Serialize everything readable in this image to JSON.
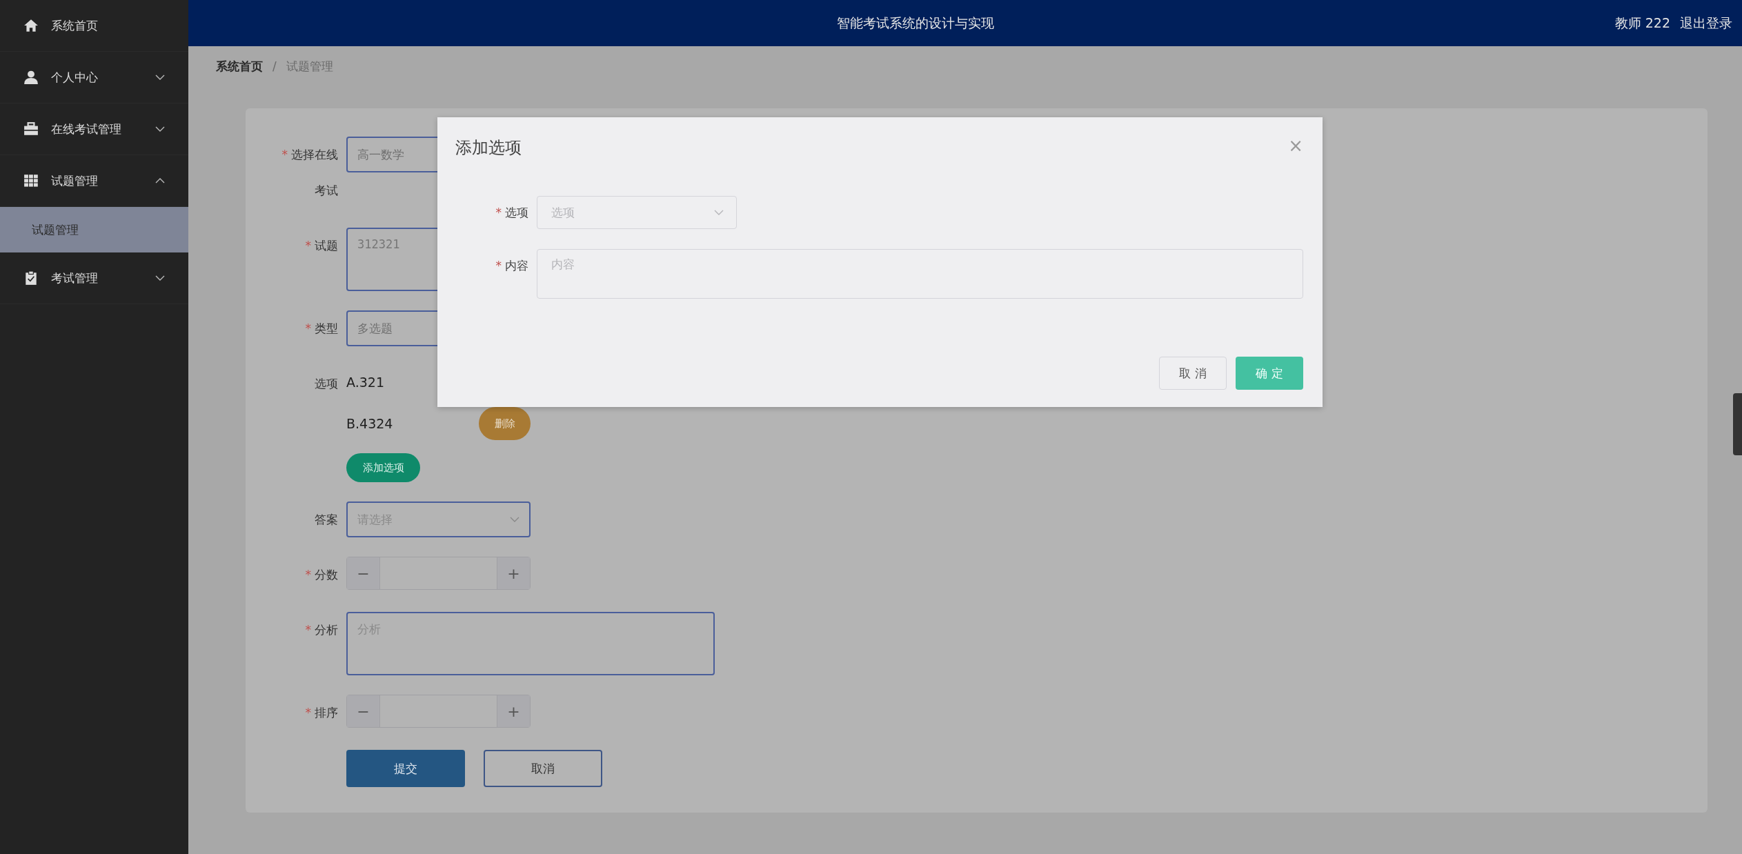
{
  "sidebar": {
    "items": [
      {
        "label": "系统首页"
      },
      {
        "label": "个人中心",
        "expanded": false
      },
      {
        "label": "在线考试管理",
        "expanded": false
      },
      {
        "label": "试题管理",
        "expanded": true,
        "children": [
          {
            "label": "试题管理",
            "selected": true
          }
        ]
      },
      {
        "label": "考试管理",
        "expanded": false
      }
    ]
  },
  "header": {
    "title": "智能考试系统的设计与实现",
    "user": "教师 222",
    "logout": "退出登录"
  },
  "breadcrumb": [
    {
      "label": "系统首页",
      "current": false
    },
    {
      "label": "试题管理",
      "current": true
    }
  ],
  "breadcrumb_separator": "/",
  "form": {
    "fields": [
      {
        "kind": "select",
        "label": "选择在线考试",
        "mark": "*",
        "value": "高一数学"
      },
      {
        "kind": "textarea",
        "label": "试题",
        "mark": "*",
        "value": "312321"
      },
      {
        "kind": "select",
        "label": "类型",
        "mark": "*",
        "value": "多选题"
      },
      {
        "kind": "options",
        "label": "选项",
        "options": [
          {
            "text": "A.321"
          },
          {
            "text": "B.4324",
            "delete_label": "删除"
          }
        ],
        "add_label": "添加选项"
      },
      {
        "kind": "select",
        "label": "答案",
        "placeholder": "请选择",
        "arrow": true
      },
      {
        "kind": "number",
        "label": "分数",
        "mark": "*",
        "minus": "−",
        "plus": "+"
      },
      {
        "kind": "textarea",
        "label": "分析",
        "mark": "*",
        "placeholder": "分析"
      },
      {
        "kind": "number",
        "label": "排序",
        "mark": "*",
        "minus": "−",
        "plus": "+"
      }
    ],
    "buttons": [
      {
        "label": "提交",
        "primary": true
      },
      {
        "label": "取消",
        "primary": false
      }
    ]
  },
  "dialog": {
    "title": "添加选项",
    "close": "×",
    "fields": [
      {
        "kind": "select",
        "label": "选项",
        "mark": "*",
        "placeholder": "选项"
      },
      {
        "kind": "textarea",
        "label": "内容",
        "mark": "*",
        "placeholder": "内容"
      }
    ],
    "buttons": [
      {
        "label": "取 消",
        "primary": false
      },
      {
        "label": "确 定",
        "primary": true
      }
    ]
  }
}
